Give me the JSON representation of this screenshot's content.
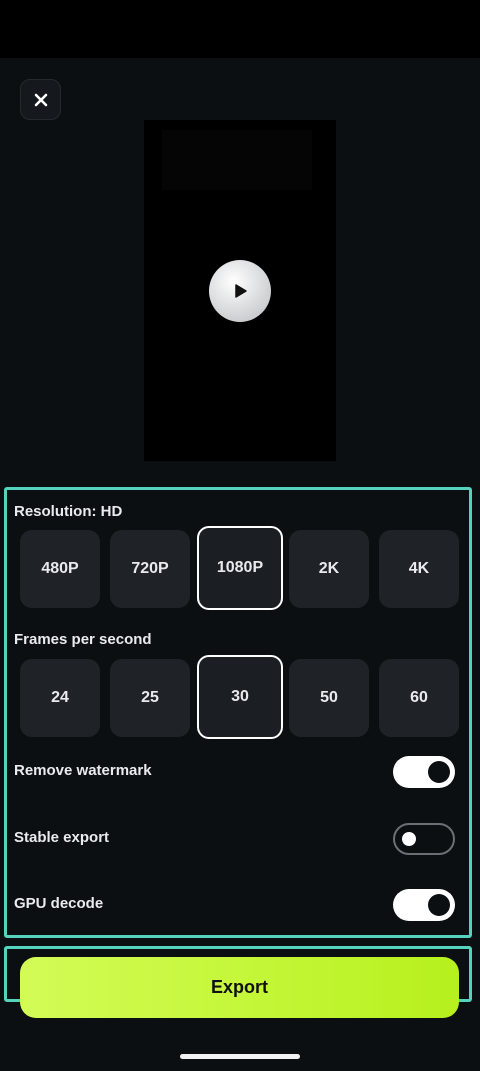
{
  "resolution": {
    "label": "Resolution: HD",
    "options": [
      "480P",
      "720P",
      "1080P",
      "2K",
      "4K"
    ],
    "selected": "1080P"
  },
  "fps": {
    "label": "Frames per second",
    "options": [
      "24",
      "25",
      "30",
      "50",
      "60"
    ],
    "selected": "30"
  },
  "toggles": [
    {
      "label": "Remove watermark",
      "on": true
    },
    {
      "label": "Stable export",
      "on": false
    },
    {
      "label": "GPU decode",
      "on": true
    }
  ],
  "export_label": "Export",
  "icons": {
    "close": "close-icon",
    "play": "play-icon"
  }
}
